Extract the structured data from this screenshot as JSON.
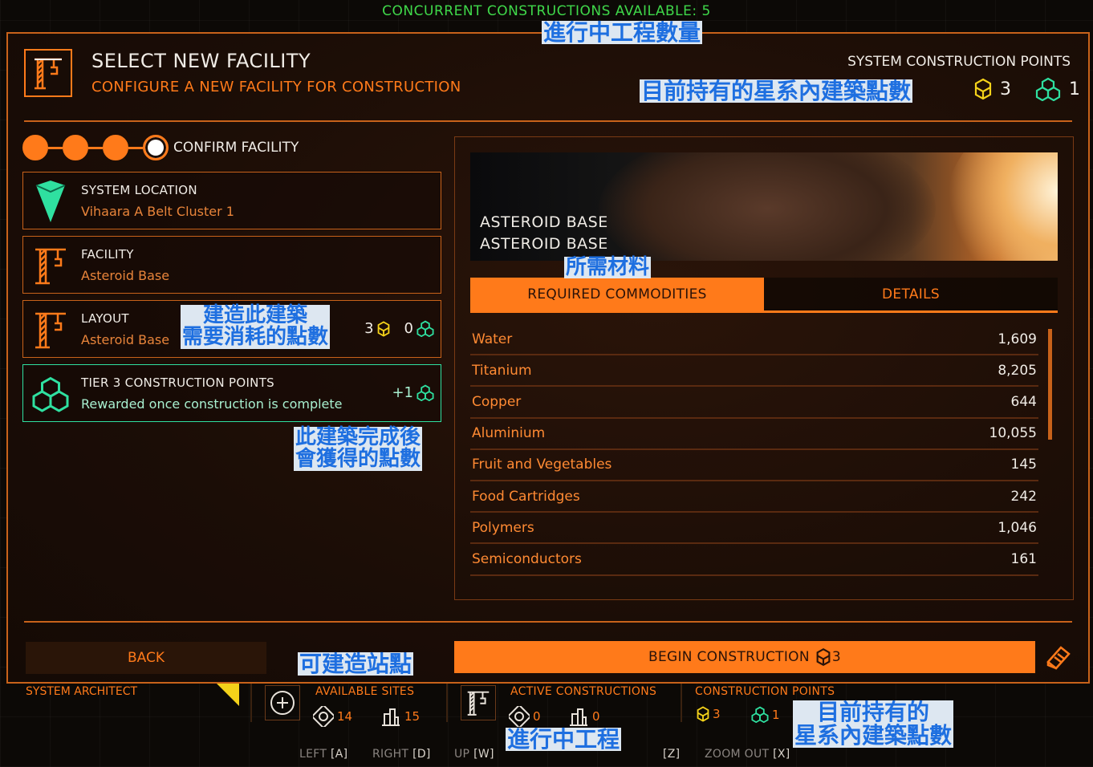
{
  "banner": "CONCURRENT CONSTRUCTIONS AVAILABLE: 5",
  "annotations": {
    "concurrent": "進行中工程數量",
    "system_points": "目前持有的星系內建築點數",
    "materials": "所需材料",
    "cost_line1": "建造此建築",
    "cost_line2": "需要消耗的點數",
    "reward_line1": "此建築完成後",
    "reward_line2": "會獲得的點數",
    "sites": "可建造站點",
    "active": "進行中工程",
    "footer_points_line1": "目前持有的",
    "footer_points_line2": "星系內建築點數"
  },
  "header": {
    "title": "SELECT NEW FACILITY",
    "subtitle": "CONFIGURE A NEW FACILITY FOR CONSTRUCTION",
    "points_label": "SYSTEM CONSTRUCTION POINTS",
    "tier2_points": "3",
    "tier3_points": "1"
  },
  "steps": {
    "label": "CONFIRM FACILITY"
  },
  "cards": {
    "location": {
      "title": "SYSTEM LOCATION",
      "value": "Vihaara A Belt Cluster 1"
    },
    "facility": {
      "title": "FACILITY",
      "value": "Asteroid Base"
    },
    "layout": {
      "title": "LAYOUT",
      "value": "Asteroid Base",
      "tier2_cost": "3",
      "tier3_cost": "0"
    },
    "reward": {
      "title": "TIER 3 CONSTRUCTION POINTS",
      "value": "Rewarded once construction is complete",
      "amount": "+1"
    }
  },
  "hero": {
    "line1": "ASTEROID BASE",
    "line2": "ASTEROID BASE"
  },
  "tabs": {
    "commodities": "REQUIRED COMMODITIES",
    "details": "DETAILS"
  },
  "commodities": [
    {
      "name": "Water",
      "qty": "1,609"
    },
    {
      "name": "Titanium",
      "qty": "8,205"
    },
    {
      "name": "Copper",
      "qty": "644"
    },
    {
      "name": "Aluminium",
      "qty": "10,055"
    },
    {
      "name": "Fruit and Vegetables",
      "qty": "145"
    },
    {
      "name": "Food Cartridges",
      "qty": "242"
    },
    {
      "name": "Polymers",
      "qty": "1,046"
    },
    {
      "name": "Semiconductors",
      "qty": "161"
    }
  ],
  "buttons": {
    "back": "BACK",
    "begin": "BEGIN CONSTRUCTION",
    "begin_cost": "3"
  },
  "footer": {
    "architect": "SYSTEM ARCHITECT",
    "sites_label": "AVAILABLE SITES",
    "sites_a": "14",
    "sites_b": "15",
    "active_label": "ACTIVE CONSTRUCTIONS",
    "active_a": "0",
    "active_b": "0",
    "points_label": "CONSTRUCTION POINTS",
    "points_t2": "3",
    "points_t3": "1"
  },
  "keys": {
    "left": "LEFT",
    "left_key": "[A]",
    "right": "RIGHT",
    "right_key": "[D]",
    "up": "UP",
    "up_key": "[W]",
    "zoomin_key": "[Z]",
    "zoomout": "ZOOM OUT",
    "zoomout_key": "[X]"
  },
  "colors": {
    "accent": "#ff7a1a",
    "tier2": "#f4d21a",
    "tier3": "#2fe0a0",
    "banner": "#3fd84a"
  }
}
